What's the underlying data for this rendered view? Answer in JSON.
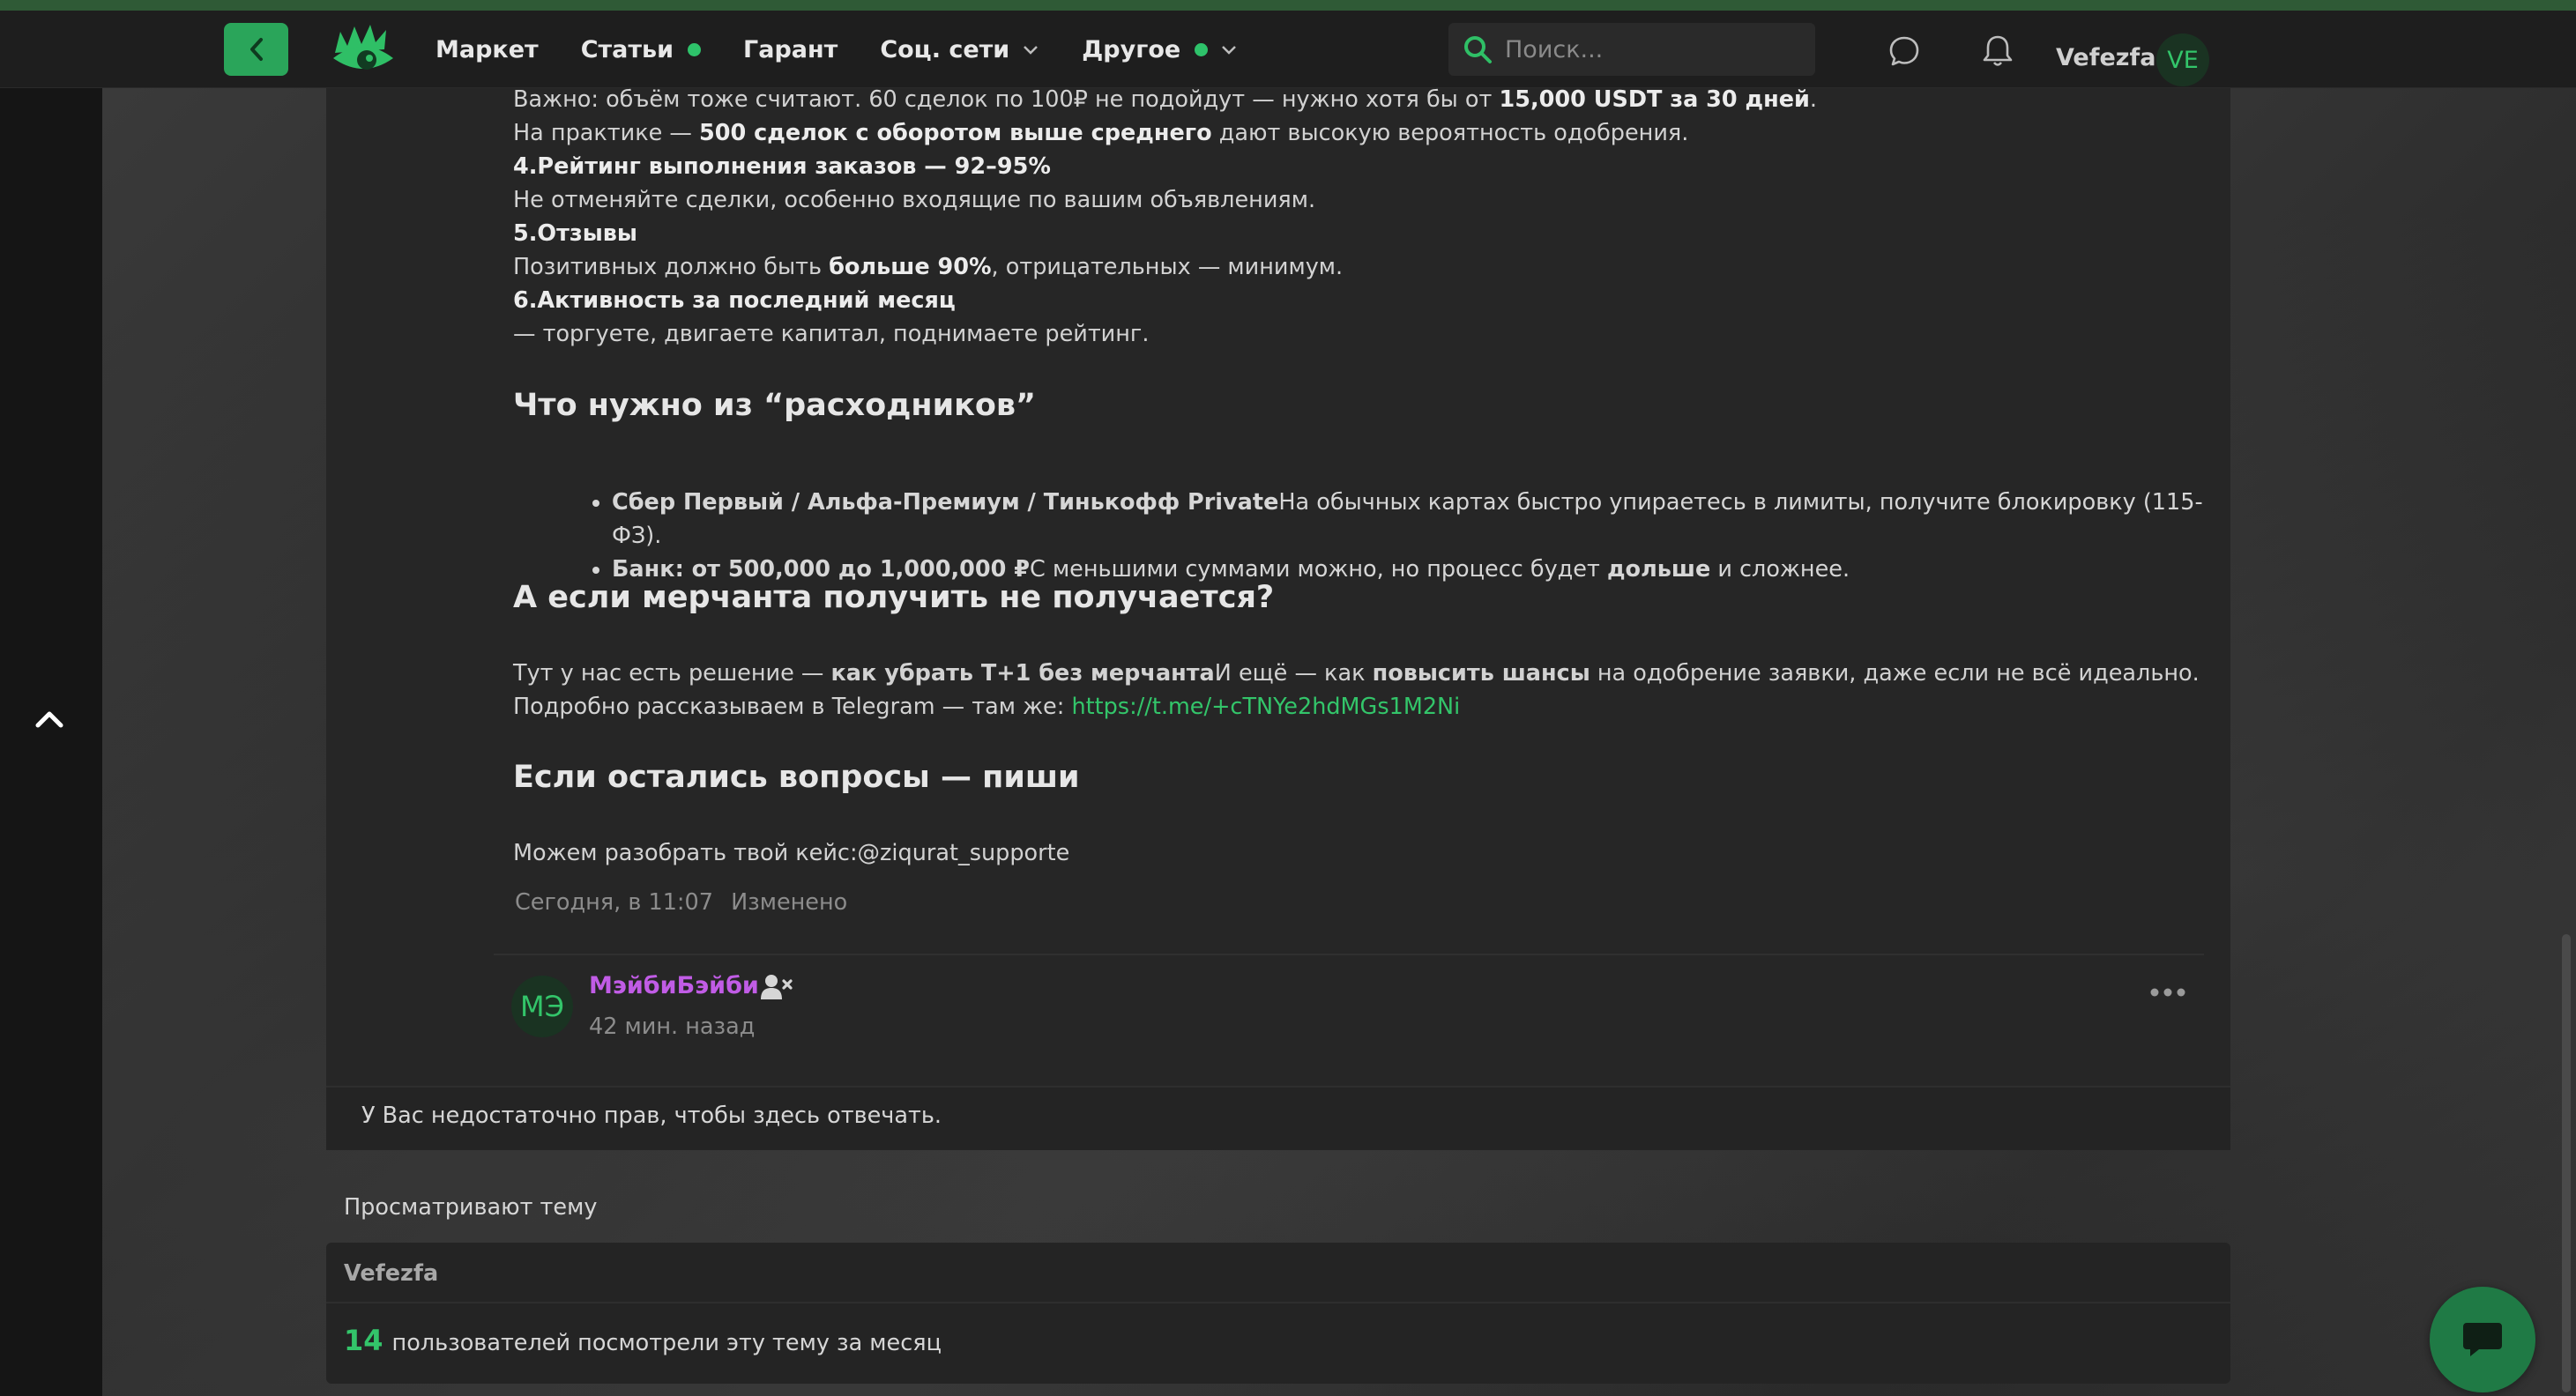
{
  "header": {
    "nav": [
      {
        "label": "Маркет"
      },
      {
        "label": "Статьи",
        "dot": true
      },
      {
        "label": "Гарант"
      },
      {
        "label": "Соц. сети",
        "dropdown": true
      },
      {
        "label": "Другое",
        "dot": true,
        "dropdown": true
      }
    ],
    "search_placeholder": "Поиск...",
    "username": "Vefezfa",
    "avatar_initials": "VE"
  },
  "post": {
    "lines": {
      "l1_a": "Важно: объём тоже считают. 60 сделок по 100₽ не подойдут — нужно хотя бы от ",
      "l1_b": "15,000 USDT за 30 дней",
      "l1_c": ".",
      "l2_a": "На практике — ",
      "l2_b": "500 сделок с оборотом выше среднего",
      "l2_c": " дают высокую вероятность одобрения.",
      "l3": "4.Рейтинг выполнения заказов — 92–95%",
      "l4": "Не отменяйте сделки, особенно входящие по вашим объявлениям.",
      "l5": "5.Отзывы",
      "l6_a": "Позитивных должно быть ",
      "l6_b": "больше 90%",
      "l6_c": ", отрицательных — минимум.",
      "l7": "6.Активность за последний месяц",
      "l8": "— торгуете, двигаете капитал, поднимаете рейтинг."
    },
    "heading_supplies": "Что нужно из “расходников”",
    "list": [
      {
        "bold": "Сбер Первый / Альфа-Премиум / Тинькофф Private",
        "text": "На обычных картах быстро упираетесь в лимиты, получите блокировку (115-ФЗ).",
        "extra_bold": "",
        "tail": ""
      },
      {
        "bold": "Банк: от 500,000 до 1,000,000 ₽",
        "text": "С меньшими суммами можно, но процесс будет ",
        "extra_bold": "дольше",
        "tail": " и сложнее."
      }
    ],
    "heading_no_merchant": "А если мерчанта получить не получается?",
    "solution": {
      "a": "Тут у нас есть решение — ",
      "b": "как убрать Т+1 без мерчанта",
      "c": "И ещё — как ",
      "d": "повысить шансы",
      "e": " на одобрение заявки, даже если не всё идеально."
    },
    "telegram": {
      "text": "Подробно рассказываем в Telegram — там же: ",
      "link": "https://t.me/+cTNYe2hdMGs1M2Ni"
    },
    "heading_questions": "Если остались вопросы — пиши",
    "contact": "Можем разобрать твой кейс:@ziqurat_supporte",
    "meta_date": "Сегодня, в 11:07",
    "meta_edited": "Изменено"
  },
  "comment": {
    "avatar_initials": "МЭ",
    "author": "МэйбиБэйби",
    "time": "42 мин. назад"
  },
  "no_permission": "У Вас недостаточно прав, чтобы здесь отвечать.",
  "viewers": {
    "label": "Просматривают тему",
    "name": "Vefezfa",
    "count": "14",
    "count_text": "пользователей посмотрели эту тему за месяц"
  },
  "colors": {
    "accent": "#33c56a",
    "accent_button": "#2aa55a",
    "author_name": "#c15ce6"
  }
}
